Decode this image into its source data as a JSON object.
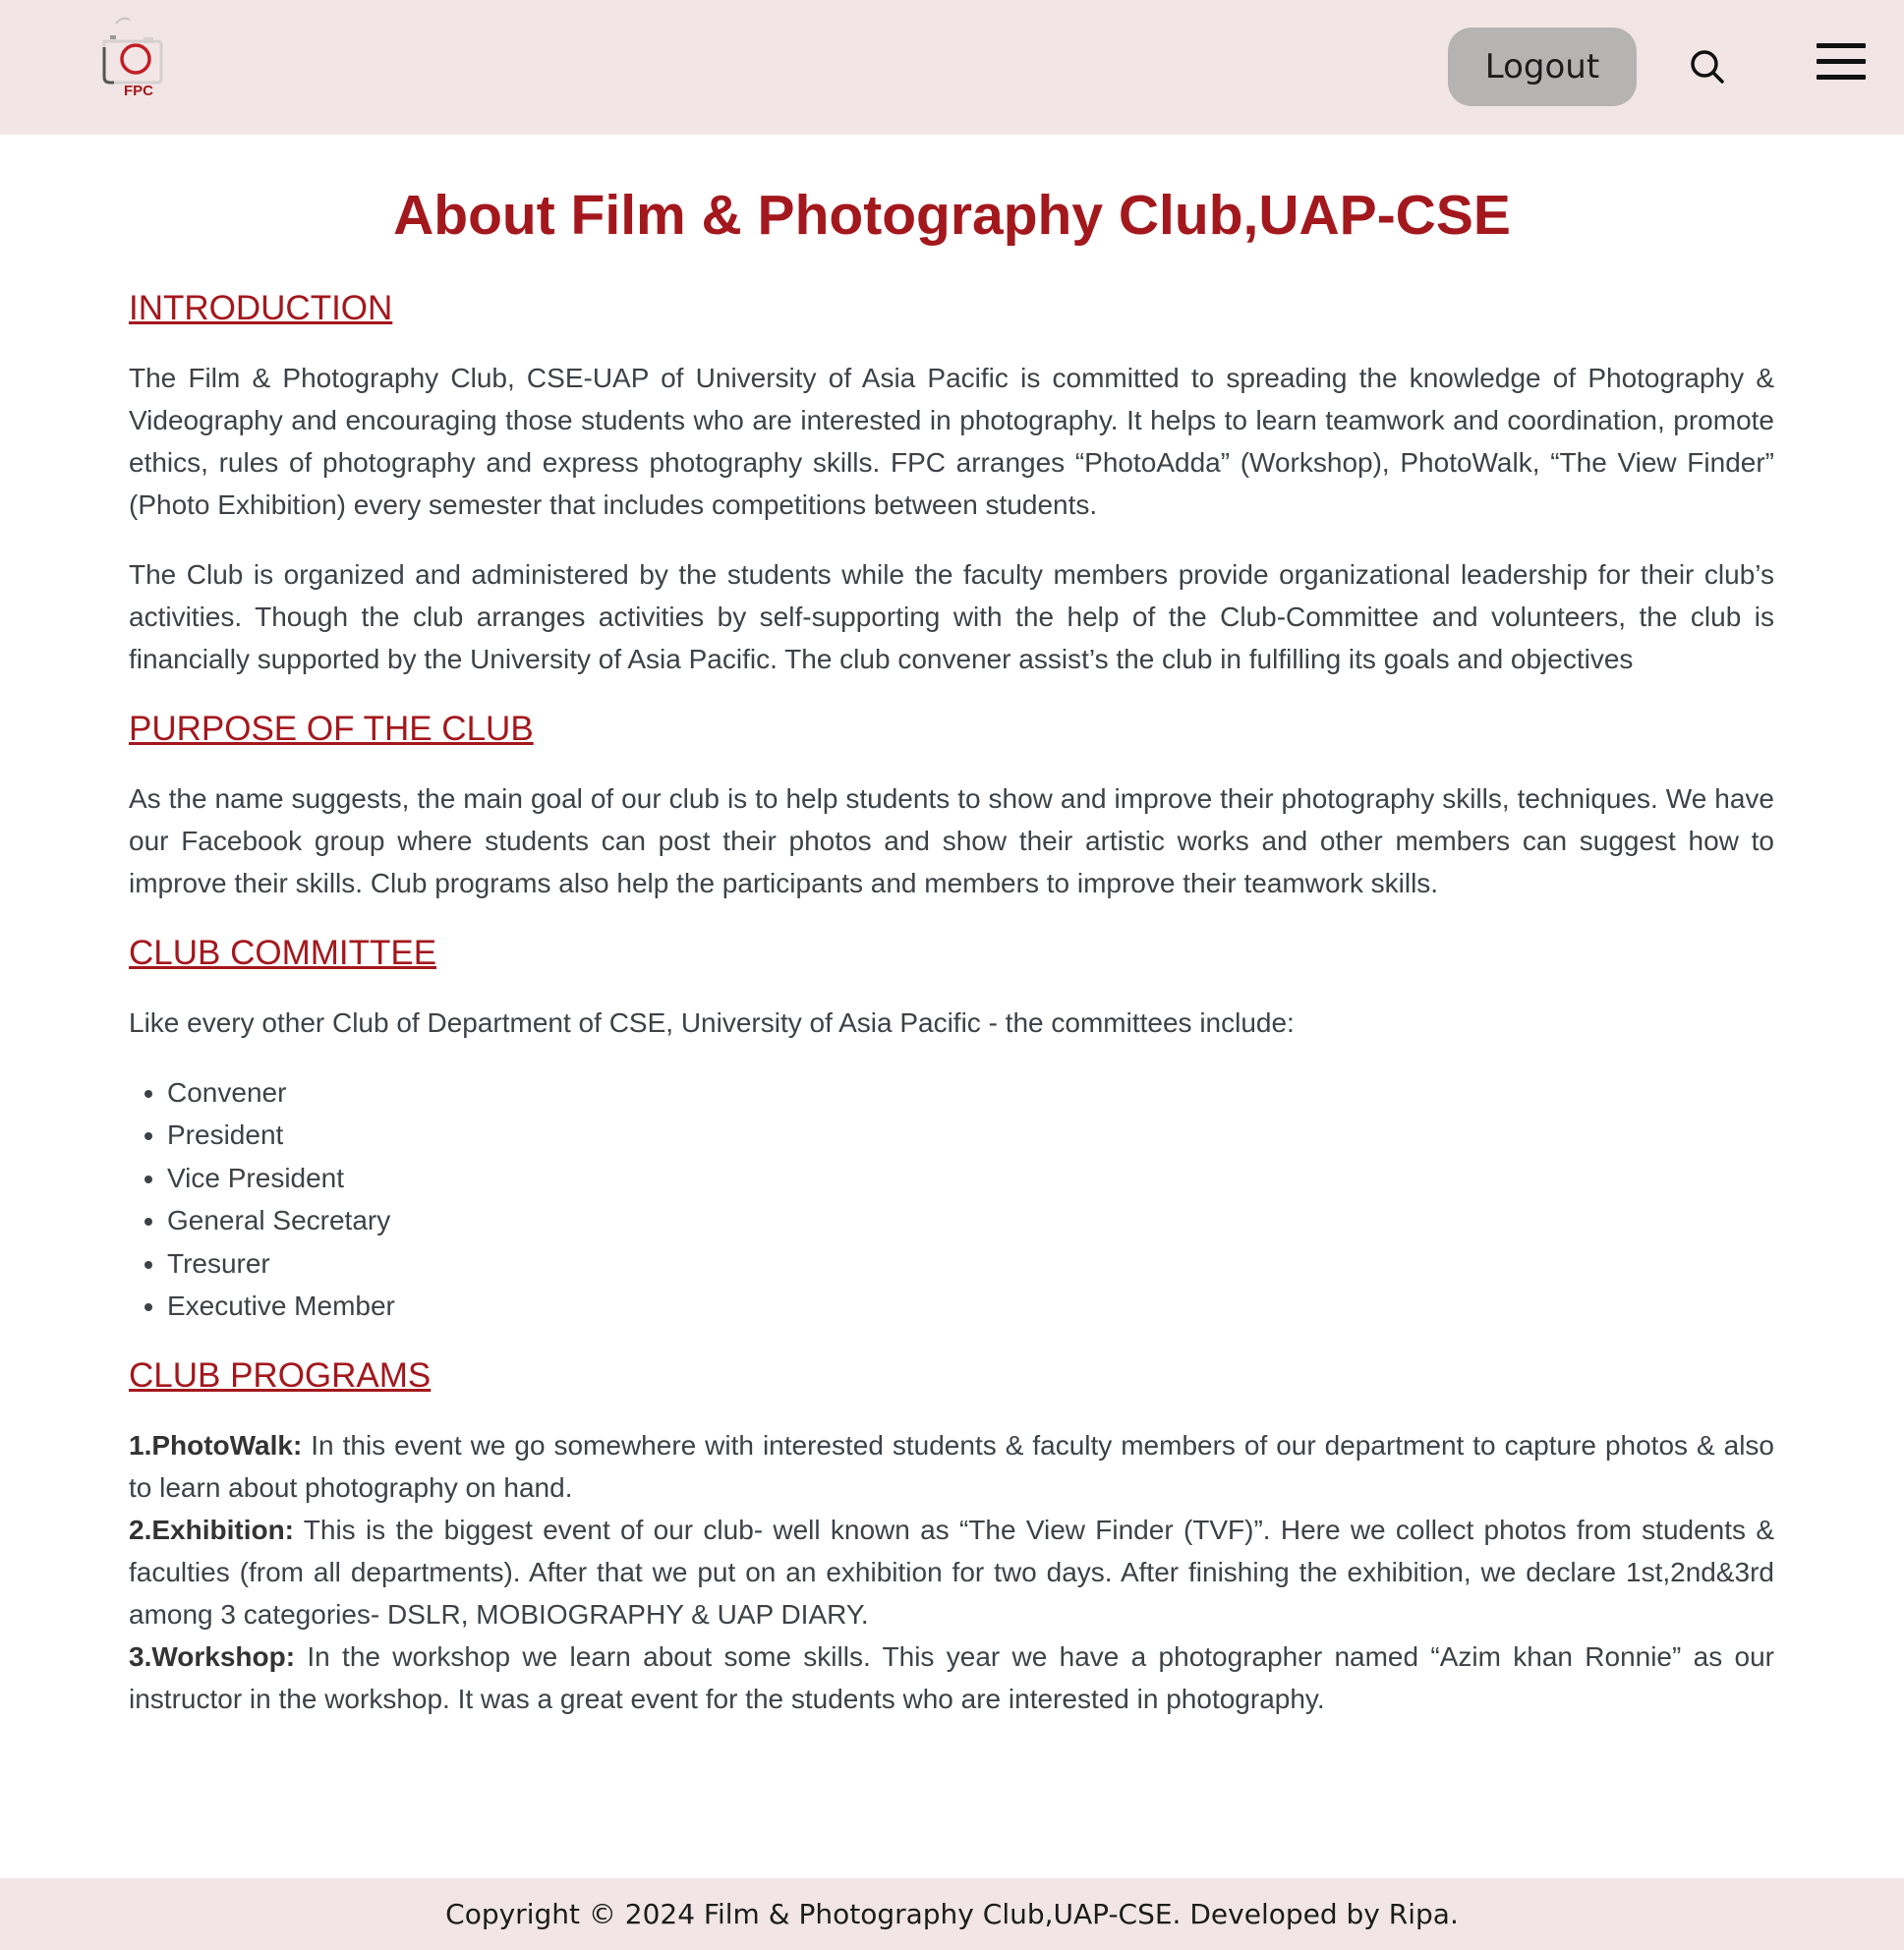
{
  "header": {
    "logo_text": "FPC",
    "logout_label": "Logout",
    "search_icon": "search-icon",
    "menu_icon": "hamburger-menu-icon"
  },
  "page_title": "About Film & Photography Club,UAP-CSE",
  "sections": {
    "introduction": {
      "heading": "INTRODUCTION",
      "paragraphs": [
        "The Film & Photography Club, CSE-UAP of University of Asia Pacific is committed to spreading the knowledge of Photography & Videography and encouraging those students who are interested in photography. It helps to learn teamwork and coordination, promote ethics, rules of photography and express photography skills. FPC arranges “PhotoAdda” (Workshop), PhotoWalk, “The View Finder” (Photo Exhibition) every semester that includes competitions between students.",
        "The Club is organized and administered by the students while the faculty members provide organizational leadership for their club’s activities. Though the club arranges activities by self-supporting with the help of the Club-Committee and volunteers, the club is financially supported by the University of Asia Pacific. The club convener assist’s the club in fulfilling its goals and objectives"
      ]
    },
    "purpose": {
      "heading": "PURPOSE OF THE CLUB",
      "paragraph": "As the name suggests, the main goal of our club is to help students to show and improve their photography skills, techniques. We have our Facebook group where students can post their photos and show their artistic works and other members can suggest how to improve their skills. Club programs also help the participants and members to improve their teamwork skills."
    },
    "committee": {
      "heading": "CLUB COMMITTEE",
      "intro": "Like every other Club of Department of CSE, University of Asia Pacific - the committees include:",
      "roles": [
        "Convener",
        "President",
        "Vice President",
        "General Secretary",
        "Tresurer",
        "Executive Member"
      ]
    },
    "programs": {
      "heading": "CLUB PROGRAMS",
      "items": [
        {
          "title": "1.PhotoWalk:",
          "text": " In this event we go somewhere with interested students & faculty members of our department to capture photos & also to learn about photography on hand."
        },
        {
          "title": "2.Exhibition:",
          "text": " This is the biggest event of our club- well known as “The View Finder (TVF)”. Here we collect photos from students & faculties (from all departments). After that we put on an exhibition for two days. After finishing the exhibition, we declare 1st,2nd&3rd among 3 categories- DSLR, MOBIOGRAPHY & UAP DIARY."
        },
        {
          "title": "3.Workshop:",
          "text": " In the workshop we learn about some skills. This year we have a photographer named “Azim khan Ronnie” as our instructor in the workshop. It was a great event for the students who are interested in photography."
        }
      ]
    }
  },
  "footer": {
    "copyright": "Copyright © 2024 Film & Photography Club,UAP-CSE. Developed by Ripa."
  },
  "colors": {
    "accent": "#a3181d",
    "header_bg": "#f1e6e5",
    "button_bg": "#b6b3b3",
    "body_text": "#3d4247"
  }
}
